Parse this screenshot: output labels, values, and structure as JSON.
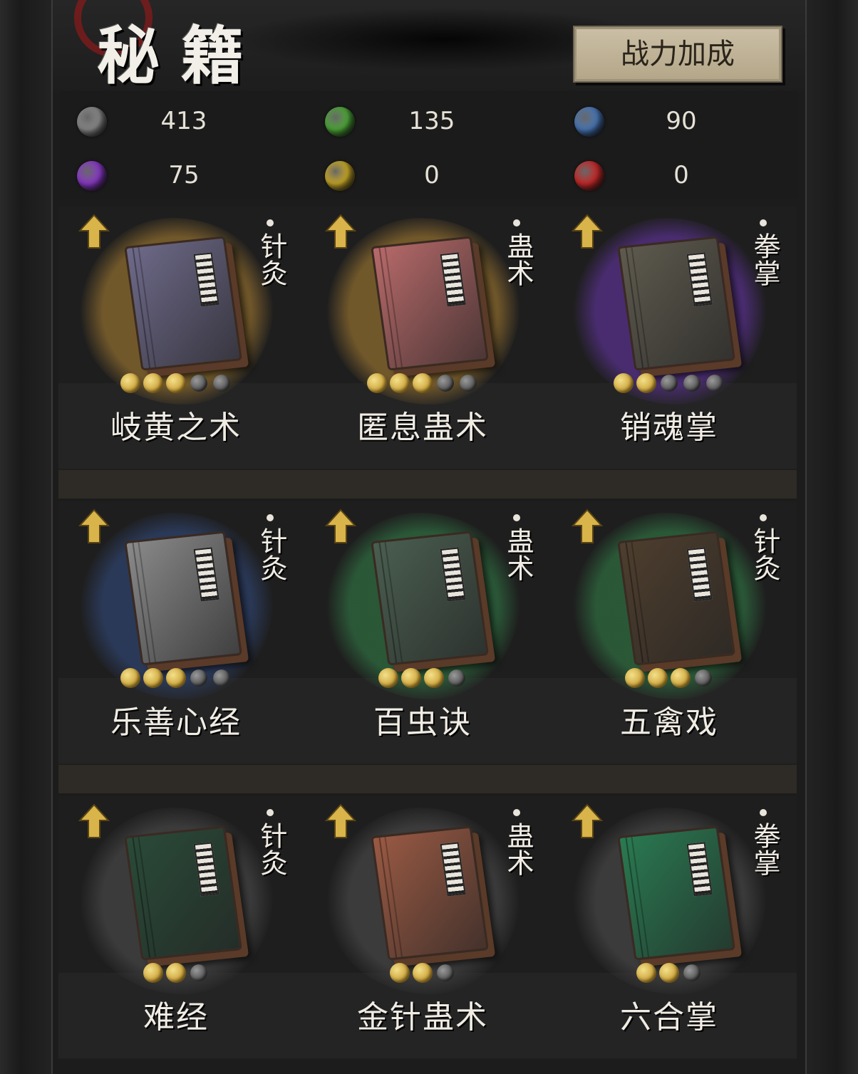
{
  "header": {
    "title": "秘籍",
    "power_button": "战力加成"
  },
  "resources": [
    {
      "orb": "gray-orb-icon",
      "color": "#8a8a8a",
      "value": "413"
    },
    {
      "orb": "green-orb-icon",
      "color": "#4fa83a",
      "value": "135"
    },
    {
      "orb": "blue-orb-icon",
      "color": "#4a78b8",
      "value": "90"
    },
    {
      "orb": "purple-orb-icon",
      "color": "#8a3ac8",
      "value": "75"
    },
    {
      "orb": "gold-orb-icon",
      "color": "#c8a828",
      "value": "0"
    },
    {
      "orb": "red-orb-icon",
      "color": "#c82a2a",
      "value": "0"
    }
  ],
  "books": [
    {
      "name": "岐黄之术",
      "category": "针灸",
      "rarity_color": "#7a5e2c",
      "book_color": "#6e6a8a",
      "stars_on": 3,
      "stars_total": 5
    },
    {
      "name": "匿息蛊术",
      "category": "蛊术",
      "rarity_color": "#7a5e2c",
      "book_color": "#b86a6a",
      "stars_on": 3,
      "stars_total": 5
    },
    {
      "name": "销魂掌",
      "category": "拳掌",
      "rarity_color": "#4e2e78",
      "book_color": "#5e5a4e",
      "stars_on": 2,
      "stars_total": 5
    },
    {
      "name": "乐善心经",
      "category": "针灸",
      "rarity_color": "#2c3c5e",
      "book_color": "#8a8a8a",
      "stars_on": 3,
      "stars_total": 5
    },
    {
      "name": "百虫诀",
      "category": "蛊术",
      "rarity_color": "#2c5e3a",
      "book_color": "#4a5e50",
      "stars_on": 3,
      "stars_total": 4
    },
    {
      "name": "五禽戏",
      "category": "针灸",
      "rarity_color": "#2c5e3a",
      "book_color": "#4e3e2e",
      "stars_on": 3,
      "stars_total": 4
    },
    {
      "name": "难经",
      "category": "针灸",
      "rarity_color": "#3e3e3e",
      "book_color": "#2a4a38",
      "stars_on": 2,
      "stars_total": 3
    },
    {
      "name": "金针蛊术",
      "category": "蛊术",
      "rarity_color": "#3e3e3e",
      "book_color": "#9a5a44",
      "stars_on": 2,
      "stars_total": 3
    },
    {
      "name": "六合掌",
      "category": "拳掌",
      "rarity_color": "#3e3e3e",
      "book_color": "#2a7a52",
      "stars_on": 2,
      "stars_total": 3
    }
  ]
}
